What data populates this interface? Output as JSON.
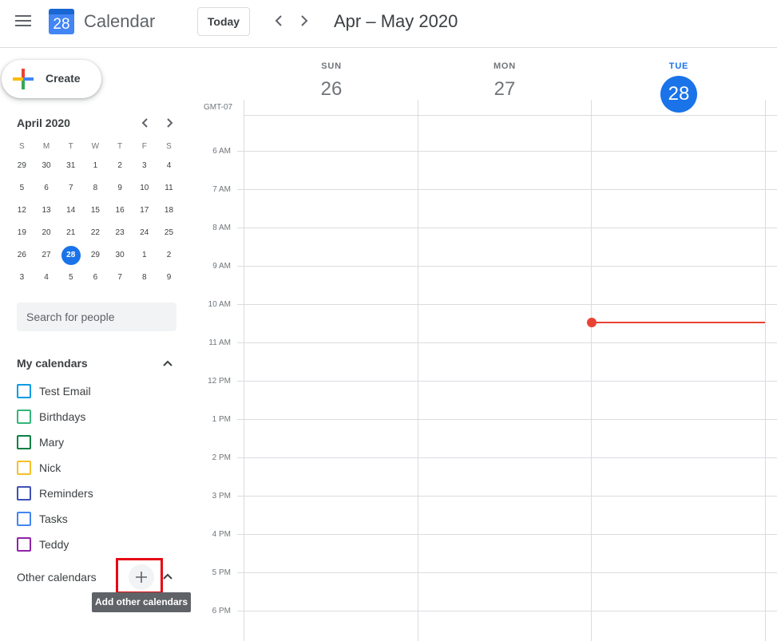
{
  "header": {
    "app_title": "Calendar",
    "logo_day": "28",
    "today_label": "Today",
    "date_range": "Apr – May 2020"
  },
  "sidebar": {
    "create_label": "Create",
    "mini_calendar": {
      "month_title": "April 2020",
      "weekdays": [
        "S",
        "M",
        "T",
        "W",
        "T",
        "F",
        "S"
      ],
      "weeks": [
        [
          "29",
          "30",
          "31",
          "1",
          "2",
          "3",
          "4"
        ],
        [
          "5",
          "6",
          "7",
          "8",
          "9",
          "10",
          "11"
        ],
        [
          "12",
          "13",
          "14",
          "15",
          "16",
          "17",
          "18"
        ],
        [
          "19",
          "20",
          "21",
          "22",
          "23",
          "24",
          "25"
        ],
        [
          "26",
          "27",
          "28",
          "29",
          "30",
          "1",
          "2"
        ],
        [
          "3",
          "4",
          "5",
          "6",
          "7",
          "8",
          "9"
        ]
      ]
    },
    "search_placeholder": "Search for people",
    "my_calendars_title": "My calendars",
    "calendars": [
      {
        "label": "Test Email",
        "color": "#039be5"
      },
      {
        "label": "Birthdays",
        "color": "#33b679"
      },
      {
        "label": "Mary",
        "color": "#0b8043"
      },
      {
        "label": "Nick",
        "color": "#f6bf26"
      },
      {
        "label": "Reminders",
        "color": "#3f51b5"
      },
      {
        "label": "Tasks",
        "color": "#4285f4"
      },
      {
        "label": "Teddy",
        "color": "#8e24aa"
      }
    ],
    "other_calendars_title": "Other calendars",
    "add_tooltip": "Add other calendars"
  },
  "week_view": {
    "timezone": "GMT-07",
    "days": [
      {
        "dow": "SUN",
        "dom": "26"
      },
      {
        "dow": "MON",
        "dom": "27"
      },
      {
        "dow": "TUE",
        "dom": "28"
      }
    ],
    "hours": [
      "6 AM",
      "7 AM",
      "8 AM",
      "9 AM",
      "10 AM",
      "11 AM",
      "12 PM",
      "1 PM",
      "2 PM",
      "3 PM",
      "4 PM",
      "5 PM",
      "6 PM"
    ]
  },
  "colors": {
    "accent": "#1a73e8",
    "now_indicator": "#ea4335",
    "highlight_box": "#e50914"
  }
}
